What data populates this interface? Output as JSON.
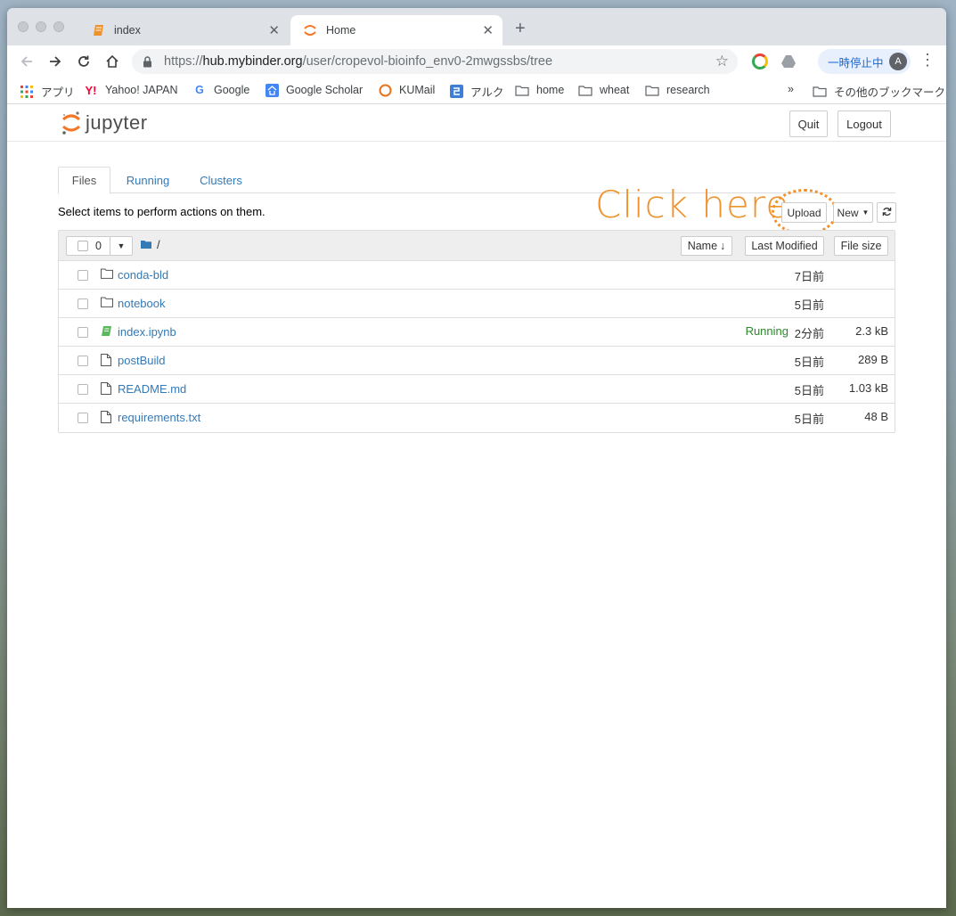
{
  "browser": {
    "tabs": [
      {
        "title": "index",
        "icon": "notebook-icon"
      },
      {
        "title": "Home",
        "icon": "jupyter-icon"
      }
    ],
    "tab_close": "✕",
    "new_tab": "+",
    "url_scheme": "https://",
    "url_host": "hub.mybinder.org",
    "url_path": "/user/cropevol-bioinfo_env0-2mwgssbs/tree",
    "pause_label": "一時停止中",
    "avatar_letter": "A"
  },
  "bookmarks": {
    "items": [
      {
        "label": "アプリ",
        "icon": "apps-grid-icon"
      },
      {
        "label": "Yahoo! JAPAN",
        "icon": "yahoo-icon"
      },
      {
        "label": "Google",
        "icon": "google-icon"
      },
      {
        "label": "Google Scholar",
        "icon": "scholar-icon"
      },
      {
        "label": "KUMail",
        "icon": "kumail-icon"
      },
      {
        "label": "アルク",
        "icon": "alc-icon"
      },
      {
        "label": "home",
        "icon": "folder-icon"
      },
      {
        "label": "wheat",
        "icon": "folder-icon"
      },
      {
        "label": "research",
        "icon": "folder-icon"
      }
    ],
    "overflow": "»",
    "other": "その他のブックマーク"
  },
  "jupyter": {
    "logo_text": "jupyter",
    "quit_label": "Quit",
    "logout_label": "Logout",
    "tabs": [
      "Files",
      "Running",
      "Clusters"
    ],
    "hint": "Select items to perform actions on them.",
    "upload_label": "Upload",
    "new_label": "New",
    "annotation": "Click here",
    "selected_count": "0",
    "breadcrumb": "/",
    "sort_name": "Name",
    "sort_modified": "Last Modified",
    "sort_size": "File size",
    "files": [
      {
        "name": "conda-bld",
        "type": "folder",
        "status": "",
        "modified": "7日前",
        "size": ""
      },
      {
        "name": "notebook",
        "type": "folder",
        "status": "",
        "modified": "5日前",
        "size": ""
      },
      {
        "name": "index.ipynb",
        "type": "notebook",
        "status": "Running",
        "modified": "2分前",
        "size": "2.3 kB"
      },
      {
        "name": "postBuild",
        "type": "file",
        "status": "",
        "modified": "5日前",
        "size": "289 B"
      },
      {
        "name": "README.md",
        "type": "file",
        "status": "",
        "modified": "5日前",
        "size": "1.03 kB"
      },
      {
        "name": "requirements.txt",
        "type": "file",
        "status": "",
        "modified": "5日前",
        "size": "48 B"
      }
    ]
  },
  "colors": {
    "accent": "#f0922c",
    "link": "#337ab7",
    "running": "#2b8a2b"
  }
}
